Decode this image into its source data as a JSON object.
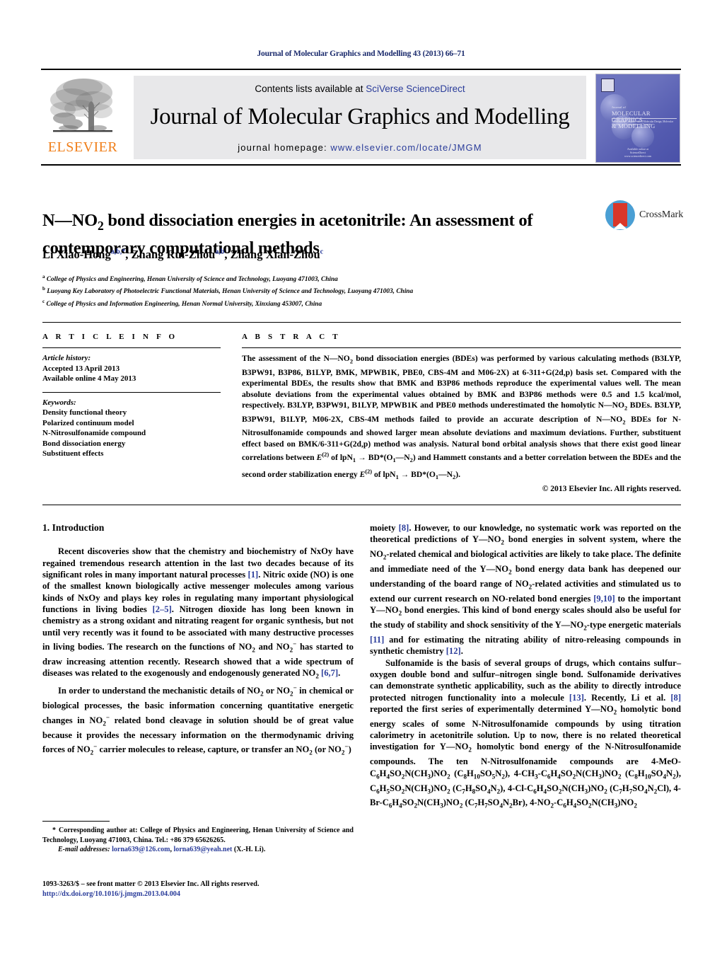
{
  "running_head": "Journal of Molecular Graphics and Modelling 43 (2013) 66–71",
  "masthead": {
    "publisher_name": "ELSEVIER",
    "contents_lead": "Contents lists available at ",
    "contents_link": "SciVerse ScienceDirect",
    "journal_title": "Journal of Molecular Graphics and Modelling",
    "homepage_label": "journal homepage: ",
    "homepage_url": "www.elsevier.com/locate/JMGM",
    "cover": {
      "kicker": "Journal of",
      "title_line1": "MOLECULAR GRAPHICS",
      "title_line2": "& MODELLING",
      "subtitle": "Incorporating Computer-aided Molecular Design, Molecular Graphics and Computational Chemistry",
      "footer_line1": "Available online at",
      "footer_line2": "ScienceDirect",
      "footer_line3": "www.sciencedirect.com"
    }
  },
  "article": {
    "title": "N—NO2 bond dissociation energies in acetonitrile: An assessment of contemporary computational methods",
    "title_part1": "N—NO",
    "title_sub": "2",
    "title_part2": " bond dissociation energies in acetonitrile: An assessment of contemporary computational methods",
    "crossmark_label": "CrossMark",
    "authors": [
      {
        "name": "Li Xiao-Hong",
        "marks": "a,b,*"
      },
      {
        "name": "Zhang Rui-Zhou",
        "marks": "a,b"
      },
      {
        "name": "Zhang Xian-Zhou",
        "marks": "c"
      }
    ],
    "affiliations": [
      {
        "mark": "a",
        "text": "College of Physics and Engineering, Henan University of Science and Technology, Luoyang 471003, China"
      },
      {
        "mark": "b",
        "text": "Luoyang Key Laboratory of Photoelectric Functional Materials, Henan University of Science and Technology, Luoyang 471003, China"
      },
      {
        "mark": "c",
        "text": "College of Physics and Information Engineering, Henan Normal University, Xinxiang 453007, China"
      }
    ]
  },
  "article_info": {
    "heading": "A R T I C L E   I N F O",
    "history_label": "Article history:",
    "history": [
      "Accepted 13 April 2013",
      "Available online 4 May 2013"
    ],
    "keywords_label": "Keywords:",
    "keywords": [
      "Density functional theory",
      "Polarized continuum model",
      "N-Nitrosulfonamide compound",
      "Bond dissociation energy",
      "Substituent effects"
    ]
  },
  "abstract": {
    "heading": "A B S T R A C T",
    "copyright": "© 2013 Elsevier Inc. All rights reserved."
  },
  "body": {
    "section1_heading": "1.  Introduction"
  },
  "footnote": {
    "corresponding_star": "*",
    "corresponding_text": "Corresponding author at: College of Physics and Engineering, Henan University of Science and Technology, Luoyang 471003, China. Tel.: +86 379 65626265.",
    "email_label": "E-mail addresses:",
    "email1": "lorna639@126.com",
    "email2": "lorna639@yeah.net",
    "email_suffix": "(X.-H. Li).",
    "issn_line": "1093-3263/$ – see front matter © 2013 Elsevier Inc. All rights reserved.",
    "doi": "http://dx.doi.org/10.1016/j.jmgm.2013.04.004"
  },
  "colors": {
    "link": "#2a3c9a",
    "elsevier_orange": "#f07f1a",
    "crossmark_blue": "#4a9fd4",
    "crossmark_red": "#d9372a",
    "banner_grey": "#e8e8ea"
  }
}
